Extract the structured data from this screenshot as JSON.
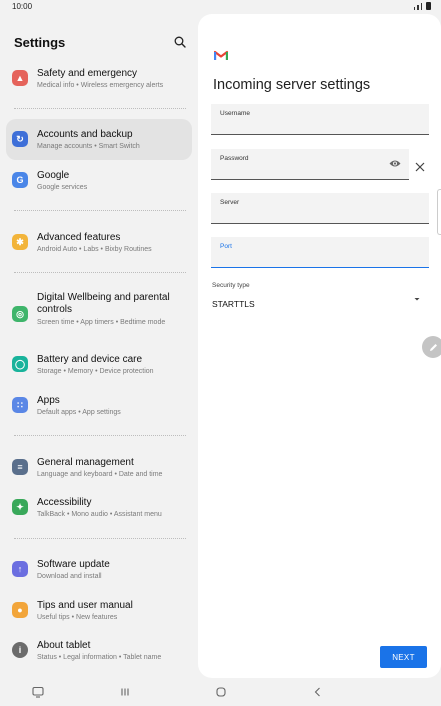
{
  "status_bar": {
    "time": "10:00"
  },
  "settings": {
    "title": "Settings",
    "items": [
      {
        "title": "Safety and emergency",
        "subtitle": "Medical info • Wireless emergency alerts",
        "icon": "siren-icon",
        "color": "#e5635b"
      },
      {
        "title": "Accounts and backup",
        "subtitle": "Manage accounts • Smart Switch",
        "icon": "sync-icon",
        "color": "#3e6fd8"
      },
      {
        "title": "Google",
        "subtitle": "Google services",
        "icon": "google-icon",
        "color": "#4a86e8"
      },
      {
        "title": "Advanced features",
        "subtitle": "Android Auto • Labs • Bixby Routines",
        "icon": "gear-plus-icon",
        "color": "#f2b43a"
      },
      {
        "title": "Digital Wellbeing and parental controls",
        "subtitle": "Screen time • App timers • Bedtime mode",
        "icon": "wellbeing-icon",
        "color": "#3fb56b"
      },
      {
        "title": "Battery and device care",
        "subtitle": "Storage • Memory • Device protection",
        "icon": "battery-care-icon",
        "color": "#19b39b"
      },
      {
        "title": "Apps",
        "subtitle": "Default apps • App settings",
        "icon": "apps-icon",
        "color": "#5a87e6"
      },
      {
        "title": "General management",
        "subtitle": "Language and keyboard • Date and time",
        "icon": "sliders-icon",
        "color": "#5a6f8c"
      },
      {
        "title": "Accessibility",
        "subtitle": "TalkBack • Mono audio • Assistant menu",
        "icon": "accessibility-icon",
        "color": "#39a85a"
      },
      {
        "title": "Software update",
        "subtitle": "Download and install",
        "icon": "update-icon",
        "color": "#6b6ee0"
      },
      {
        "title": "Tips and user manual",
        "subtitle": "Useful tips • New features",
        "icon": "lightbulb-icon",
        "color": "#f2a53a"
      },
      {
        "title": "About tablet",
        "subtitle": "Status • Legal information • Tablet name",
        "icon": "info-icon",
        "color": "#6b6b6b"
      }
    ]
  },
  "server_settings": {
    "title": "Incoming server settings",
    "username_label": "Username",
    "username_value": "",
    "password_label": "Password",
    "password_value": "",
    "server_label": "Server",
    "server_value": "",
    "port_label": "Port",
    "port_value": "",
    "security_label": "Security type",
    "security_value": "STARTTLS",
    "next_label": "NEXT"
  },
  "colors": {
    "accent": "#1a73e8",
    "active_item": "#e3e3e3"
  }
}
